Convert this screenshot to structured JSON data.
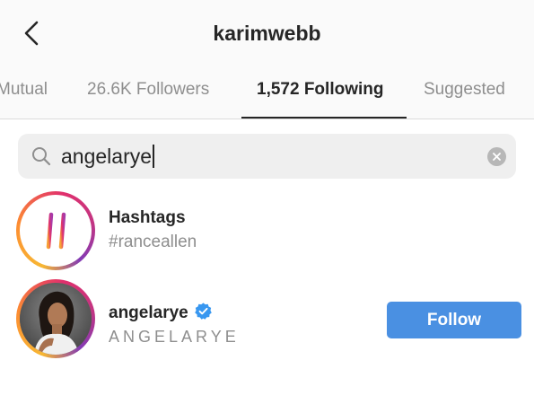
{
  "header": {
    "title": "karimwebb"
  },
  "tabs": [
    {
      "label": "Mutual",
      "active": false
    },
    {
      "label": "26.6K Followers",
      "active": false
    },
    {
      "label": "1,572 Following",
      "active": true
    },
    {
      "label": "Suggested",
      "active": false
    }
  ],
  "search": {
    "value": "angelarye"
  },
  "results": [
    {
      "type": "hashtag",
      "title": "Hashtags",
      "subtitle": "#ranceallen",
      "icon": "hashtag-icon"
    },
    {
      "type": "user",
      "username": "angelarye",
      "full_name": "ANGELARYE",
      "verified": true,
      "action_label": "Follow"
    }
  ],
  "colors": {
    "follow_button": "#4a90e2",
    "verified_badge": "#3897f0",
    "muted_text": "#8e8e8e",
    "primary_text": "#262626"
  }
}
